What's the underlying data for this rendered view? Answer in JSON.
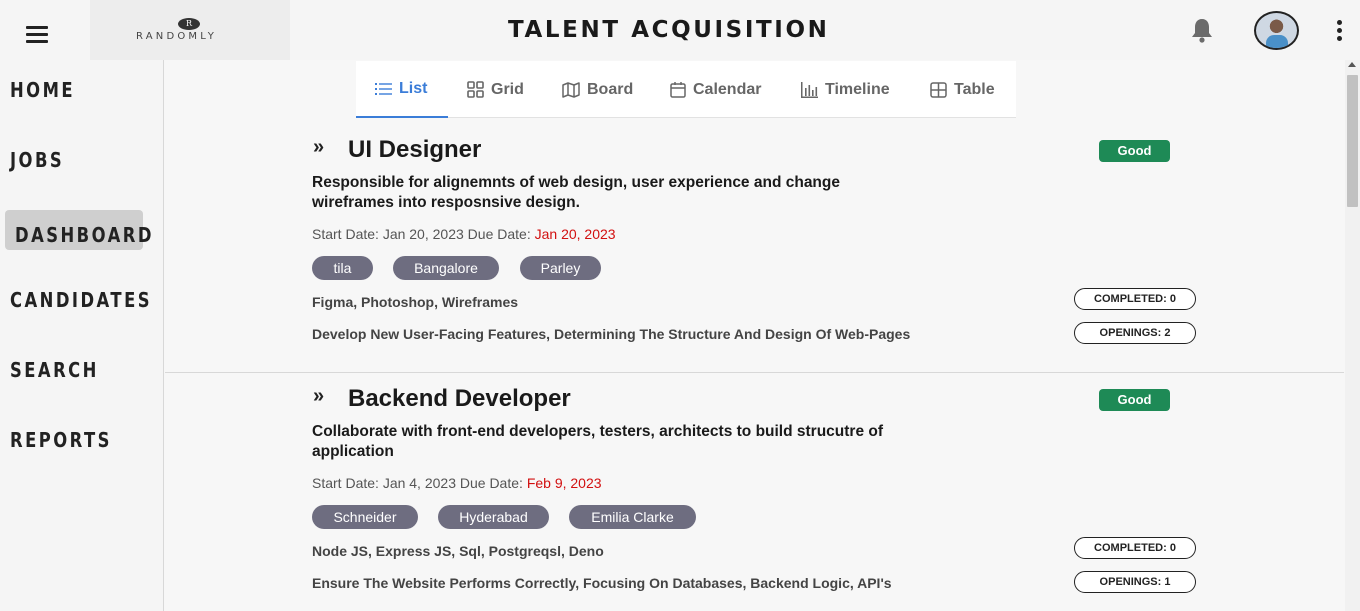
{
  "header": {
    "brand": "RANDOMLY",
    "brand_mark": "R",
    "title": "TALENT ACQUISITION",
    "menu_icon": "hamburger-icon",
    "notification_icon": "bell-icon",
    "more_icon": "kebab-icon"
  },
  "sidebar": {
    "items": [
      {
        "label": "HOME"
      },
      {
        "label": "JOBS"
      },
      {
        "label": "DASHBOARD",
        "active": true
      },
      {
        "label": "CANDIDATES"
      },
      {
        "label": "SEARCH"
      },
      {
        "label": "REPORTS"
      }
    ]
  },
  "view_tabs": [
    {
      "label": "List",
      "icon": "list-icon",
      "active": true
    },
    {
      "label": "Grid",
      "icon": "grid-icon"
    },
    {
      "label": "Board",
      "icon": "map-icon"
    },
    {
      "label": "Calendar",
      "icon": "calendar-icon"
    },
    {
      "label": "Timeline",
      "icon": "bar-chart-icon"
    },
    {
      "label": "Table",
      "icon": "table-icon"
    }
  ],
  "jobs": [
    {
      "title": "UI Designer",
      "status": "Good",
      "description": "Responsible for alignemnts of web design, user experience and change wireframes into resposnsive design.",
      "start_label": "Start Date:",
      "start_date": "Jan 20, 2023",
      "due_label": "Due Date:",
      "due_date": "Jan 20, 2023",
      "tags": [
        "tila",
        "Bangalore",
        "Parley"
      ],
      "skills": "Figma, Photoshop, Wireframes",
      "responsibilities": "Develop New User-Facing Features, Determining The Structure And Design Of Web-Pages",
      "completed": "COMPLETED: 0",
      "openings": "OPENINGS: 2"
    },
    {
      "title": "Backend Developer",
      "status": "Good",
      "description": "Collaborate with front-end developers, testers, architects to build strucutre of application",
      "start_label": "Start Date:",
      "start_date": "Jan 4, 2023",
      "due_label": "Due Date:",
      "due_date": "Feb 9, 2023",
      "tags": [
        "Schneider",
        "Hyderabad",
        "Emilia Clarke"
      ],
      "skills": "Node JS, Express JS, Sql, Postgreqsl, Deno",
      "responsibilities": "Ensure The Website Performs Correctly, Focusing On Databases, Backend Logic, API's",
      "completed": "COMPLETED: 0",
      "openings": "OPENINGS: 1"
    }
  ],
  "colors": {
    "accent": "#3b7dd8",
    "good": "#1e8a56",
    "due": "#d21010",
    "chip": "#6e6d80"
  }
}
